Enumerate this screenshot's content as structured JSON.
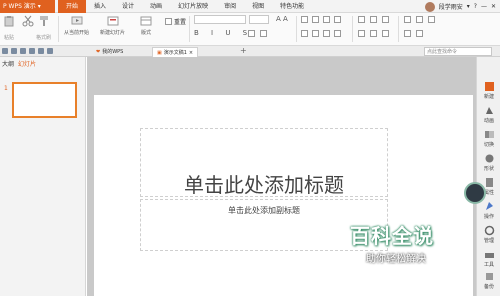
{
  "app": {
    "name": "WPS 演示"
  },
  "tabs": [
    "开始",
    "插入",
    "设计",
    "动画",
    "幻灯片放映",
    "审阅",
    "视图",
    "特色功能"
  ],
  "user": {
    "name": "段学雨安"
  },
  "ribbon": {
    "paste_label": "粘贴",
    "format_painter_label": "格式刷",
    "from_current_label": "从当前开始",
    "new_slide_label": "新建幻灯片",
    "layout_label": "版式",
    "reset_label": "重置"
  },
  "doc_tabs": {
    "my_wps": "我的WPS",
    "active": "演示文稿1",
    "find_placeholder": "点此查找命令"
  },
  "left_panel": {
    "outline_tab": "大纲",
    "slides_tab": "幻灯片",
    "slide_number": "1"
  },
  "slide": {
    "title": "单击此处添加标题",
    "subtitle": "单击此处添加副标题"
  },
  "right_sidebar": [
    "新建",
    "动画",
    "切换",
    "形状",
    "属性",
    "操作",
    "管理",
    "工具",
    "备份"
  ],
  "watermark": {
    "title": "百科全说",
    "subtitle": "助你轻松解决"
  },
  "colors": {
    "accent": "#e0611f"
  }
}
